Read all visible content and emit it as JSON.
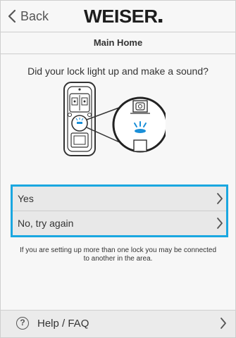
{
  "header": {
    "back_label": "Back",
    "brand": "WEISER",
    "title": "Main Home"
  },
  "content": {
    "question": "Did your lock light up and make a sound?",
    "illustration_icon": "lock-light-illustration",
    "options": [
      {
        "label": "Yes",
        "icon": "chevron-right-icon"
      },
      {
        "label": "No, try again",
        "icon": "chevron-right-icon"
      }
    ],
    "note": "If you are setting up more than one lock you may be connected to another in the area."
  },
  "footer": {
    "help_icon_glyph": "?",
    "help_label": "Help / FAQ"
  },
  "colors": {
    "highlight": "#1aa7e0",
    "led_blue": "#1a8fd8",
    "background": "#f7f7f7"
  }
}
